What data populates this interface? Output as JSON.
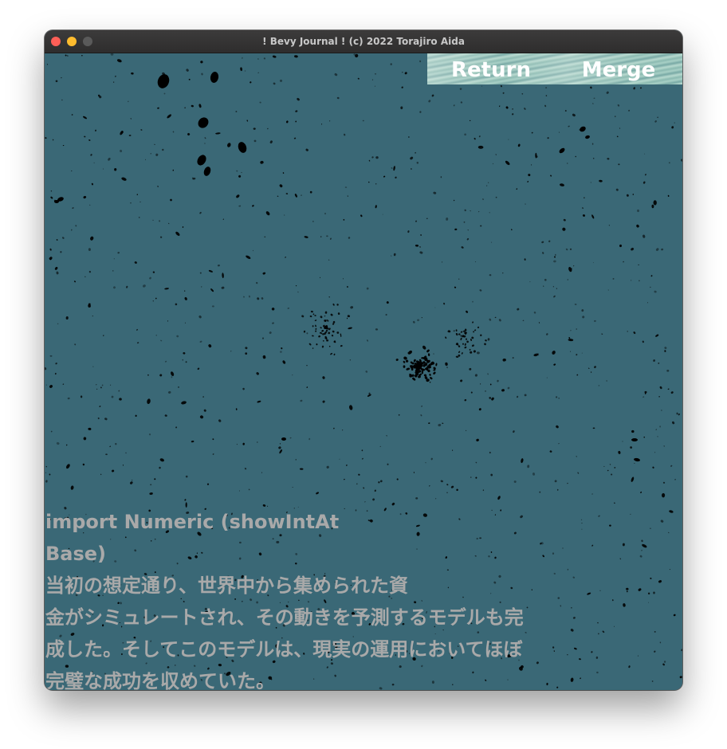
{
  "window": {
    "title": "! Bevy Journal ! (c) 2022 Torajiro Aida"
  },
  "toolbar": {
    "return_label": "Return",
    "merge_label": "Merge"
  },
  "journal": {
    "lines": [
      "import Numeric (showIntAt",
      "Base)",
      "当初の想定通り、世界中から集められた資",
      "金がシミュレートされ、その動きを予測するモデルも完",
      "成した。そしてこのモデルは、現実の運用においてほぼ",
      "完璧な成功を収めていた。"
    ]
  },
  "colors": {
    "scene_background": "#3a6876",
    "particle": "#000000",
    "journal_text": "#a9a9a9",
    "titlebar": "#353434"
  }
}
